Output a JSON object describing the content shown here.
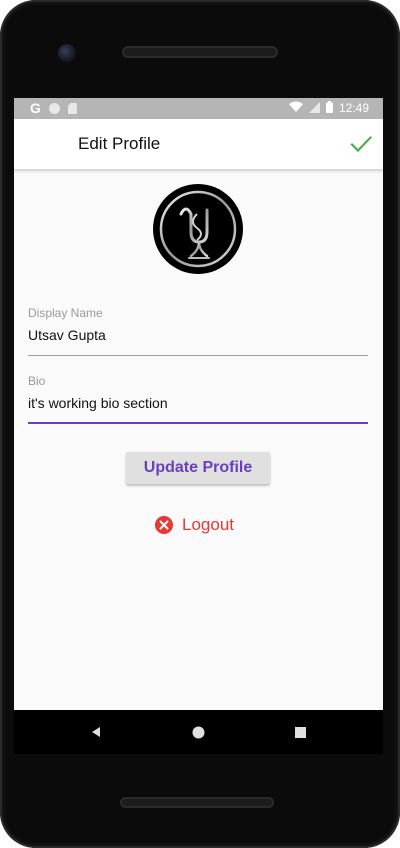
{
  "status_bar": {
    "left_icons": [
      "google-g-icon",
      "circle-icon",
      "sd-card-icon"
    ],
    "google_letter": "G",
    "right_icons": [
      "wifi-icon",
      "cell-signal-icon",
      "battery-icon"
    ],
    "time": "12:49"
  },
  "app_bar": {
    "title": "Edit Profile",
    "action_icon": "check-icon",
    "action_color": "#4caf50"
  },
  "profile": {
    "avatar_icon": "monogram-logo-icon"
  },
  "form": {
    "display_name": {
      "label": "Display Name",
      "value": "Utsav Gupta"
    },
    "bio": {
      "label": "Bio",
      "value": "it's working bio section"
    }
  },
  "actions": {
    "update_label": "Update Profile",
    "logout_label": "Logout",
    "logout_icon": "close-circle-icon"
  },
  "nav_bar": {
    "items": [
      "back-icon",
      "home-icon",
      "recents-icon"
    ]
  },
  "colors": {
    "accent": "#6a3fbd",
    "danger": "#e53935",
    "success": "#4caf50"
  }
}
